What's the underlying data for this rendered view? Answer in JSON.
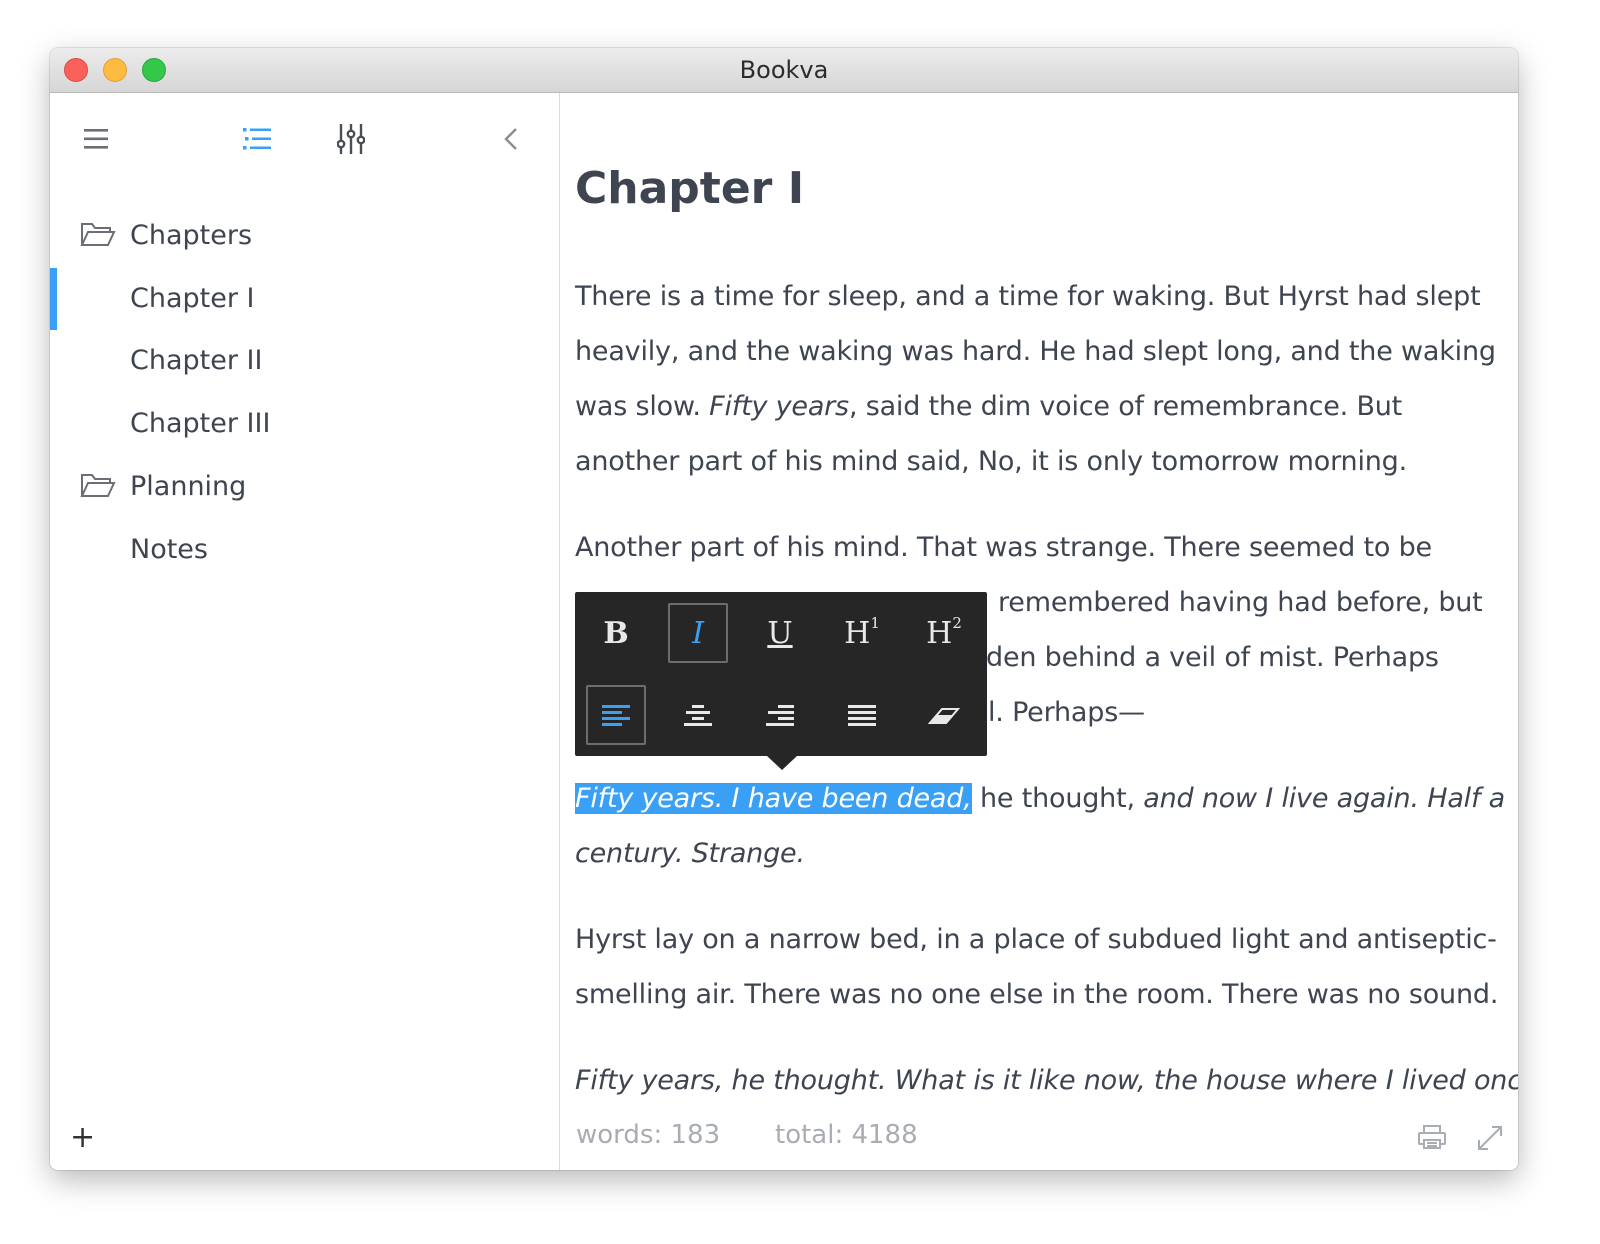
{
  "window": {
    "title": "Bookva"
  },
  "sidebar": {
    "toolbar": {
      "menu_icon": "hamburger-menu-icon",
      "outline_icon": "list-icon",
      "settings_icon": "sliders-icon",
      "collapse_icon": "chevron-left-icon"
    },
    "tree": [
      {
        "type": "folder",
        "label": "Chapters",
        "icon": "folder-open-icon"
      },
      {
        "type": "item",
        "label": "Chapter I",
        "active": true
      },
      {
        "type": "item",
        "label": "Chapter II"
      },
      {
        "type": "item",
        "label": "Chapter III"
      },
      {
        "type": "folder",
        "label": "Planning",
        "icon": "folder-open-icon"
      },
      {
        "type": "item",
        "label": "Notes"
      }
    ],
    "add_label": "+"
  },
  "editor": {
    "heading": "Chapter I",
    "p1": {
      "a": "There is a time for sleep, and a time for waking. But Hyrst had slept heavily, and the waking was hard. He had slept long, and the waking was slow. ",
      "b": "Fifty years",
      "c": ", said the dim voice of remembrance. But another part of his mind said, No, it is only tomorrow morning."
    },
    "p2": {
      "line1": "Another part of his mind. That was strange. There seemed to be",
      "line2_visible": "remembered having had before, but",
      "line3_visible": "den behind a veil of mist. Perhaps",
      "line4_visible": "l. Perhaps—"
    },
    "p3": {
      "selected": "Fifty years. I have been dead,",
      "a": " he thought, ",
      "b": "and now I live again. Half a century. Strange."
    },
    "p4": "Hyrst lay on a narrow bed, in a place of subdued light and antiseptic-smelling air. There was no one else in the room. There was no sound.",
    "p5": "Fifty years, he thought. What is it like now, the house where I lived once,"
  },
  "format_toolbar": {
    "row1": [
      {
        "name": "bold-button",
        "label": "B",
        "active": false
      },
      {
        "name": "italic-button",
        "label": "I",
        "active": true
      },
      {
        "name": "underline-button",
        "label": "U",
        "active": false
      },
      {
        "name": "heading1-button",
        "label": "H",
        "sup": "1",
        "active": false
      },
      {
        "name": "heading2-button",
        "label": "H",
        "sup": "2",
        "active": false
      }
    ],
    "row2": [
      {
        "name": "align-left-button",
        "icon": "align-left-icon",
        "active": true
      },
      {
        "name": "align-center-button",
        "icon": "align-center-icon",
        "active": false
      },
      {
        "name": "align-right-button",
        "icon": "align-right-icon",
        "active": false
      },
      {
        "name": "align-justify-button",
        "icon": "align-justify-icon",
        "active": false
      },
      {
        "name": "clear-format-button",
        "icon": "eraser-icon",
        "active": false
      }
    ]
  },
  "status": {
    "words": "words: 183",
    "total": "total: 4188",
    "print_icon": "printer-icon",
    "fullscreen_icon": "expand-icon"
  },
  "colors": {
    "accent": "#3aa0f5",
    "text": "#3e4551",
    "toolbar_bg": "#262626",
    "muted": "#a8adb3"
  }
}
